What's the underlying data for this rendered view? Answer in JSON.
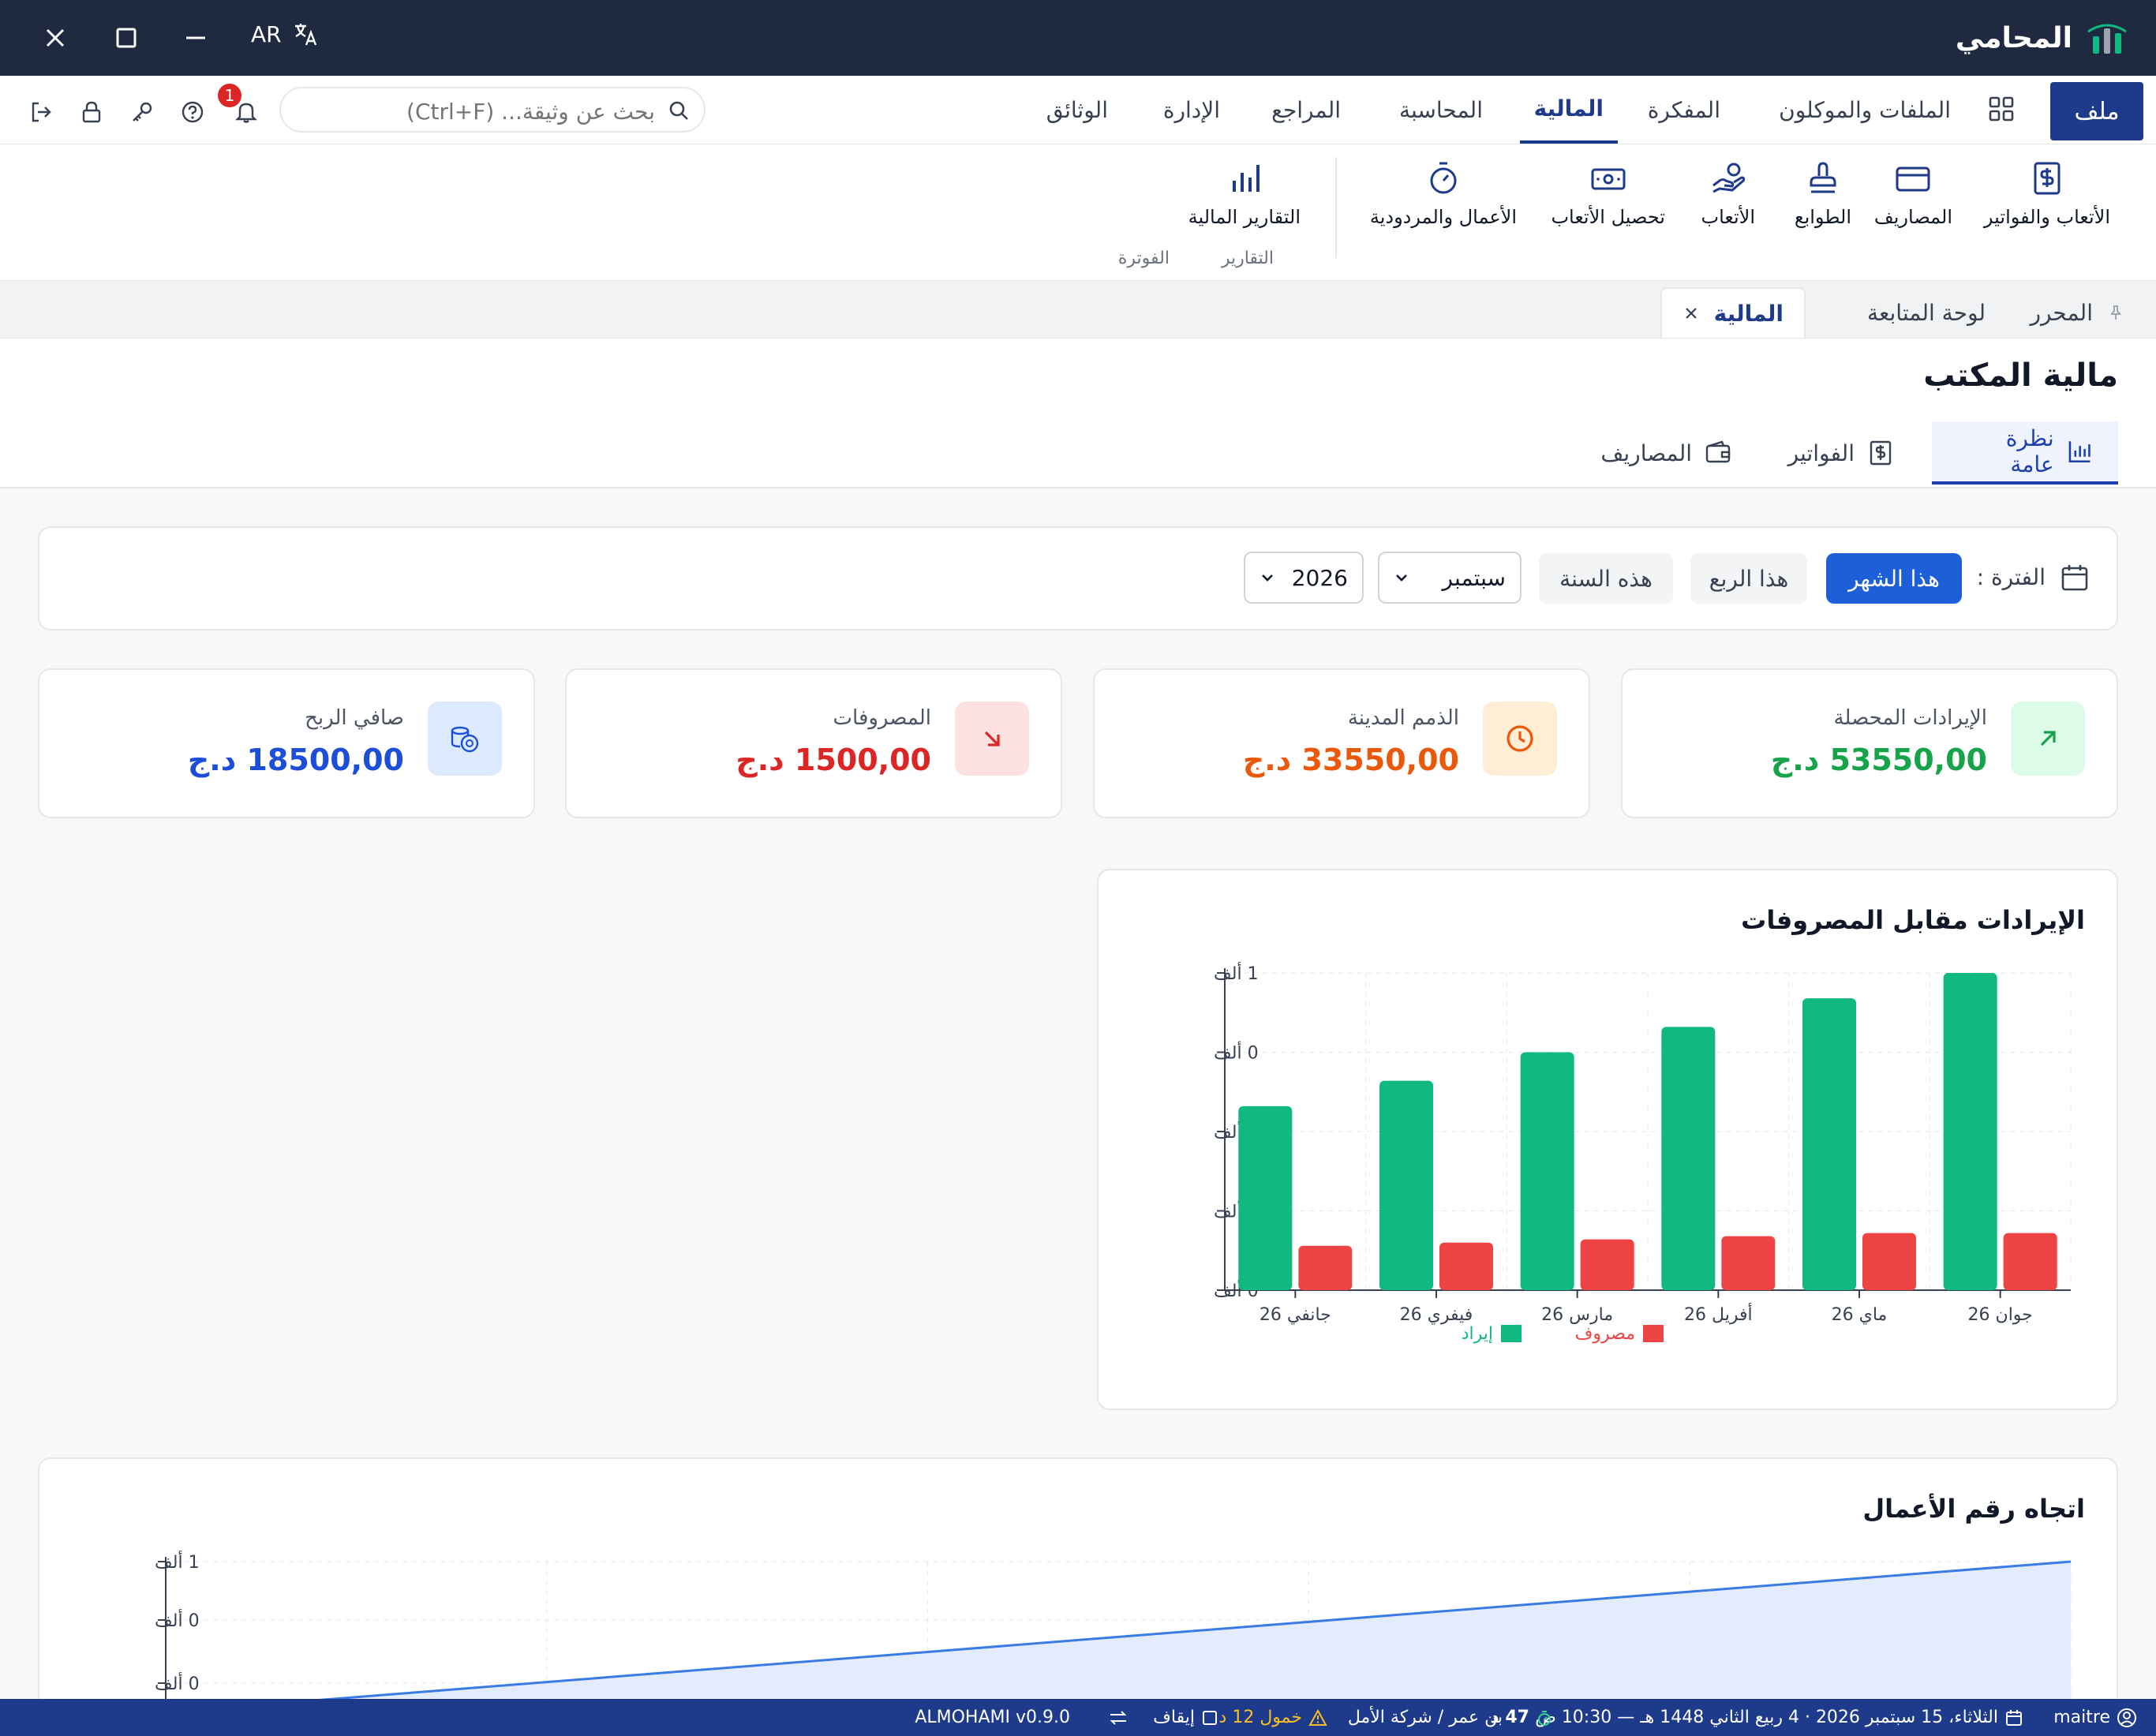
{
  "app": {
    "name": "المحامي",
    "lang": "AR"
  },
  "menu": {
    "file": "ملف",
    "items": [
      "الملفات والموكلون",
      "المفكرة",
      "المالية",
      "المحاسبة",
      "المراجع",
      "الإدارة",
      "الوثائق"
    ],
    "active": "المالية"
  },
  "search": {
    "placeholder": "بحث عن وثيقة... (Ctrl+F)"
  },
  "notifications": {
    "count": "1"
  },
  "ribbon": {
    "billing_group": "الفوترة",
    "reports_group": "التقارير",
    "buttons": [
      {
        "label": "الأتعاب والفواتير",
        "icon": "invoice-dollar-icon"
      },
      {
        "label": "المصاريف",
        "icon": "credit-card-icon"
      },
      {
        "label": "الطوابع",
        "icon": "stamp-icon"
      },
      {
        "label": "الأتعاب",
        "icon": "hand-coins-icon"
      },
      {
        "label": "تحصيل الأتعاب",
        "icon": "banknote-icon"
      },
      {
        "label": "الأعمال والمردودية",
        "icon": "stopwatch-icon"
      },
      {
        "label": "التقارير المالية",
        "icon": "bar-chart-icon"
      }
    ]
  },
  "doc_tabs": {
    "editor": "المحرر",
    "dashboard": "لوحة المتابعة",
    "finance": "المالية"
  },
  "page": {
    "title": "مالية المكتب",
    "tabs": [
      "نظرة عامة",
      "الفواتير",
      "المصاريف"
    ]
  },
  "filter": {
    "label": "الفترة :",
    "this_month": "هذا الشهر",
    "this_quarter": "هذا الربع",
    "this_year": "هذه السنة",
    "month": "سبتمبر",
    "year": "2026"
  },
  "kpis": [
    {
      "label": "الإيرادات المحصلة",
      "value": "53550,00 د.ج",
      "color": "#16a34a",
      "icon": "arrow-up-right-icon"
    },
    {
      "label": "الذمم المدينة",
      "value": "33550,00 د.ج",
      "color": "#ea580c",
      "icon": "clock-icon"
    },
    {
      "label": "المصروفات",
      "value": "1500,00 د.ج",
      "color": "#dc2626",
      "icon": "arrow-down-right-icon"
    },
    {
      "label": "صافي الربح",
      "value": "18500,00 د.ج",
      "color": "#1d4ed8",
      "icon": "coins-icon"
    }
  ],
  "chart_data": [
    {
      "type": "bar",
      "title": "الإيرادات مقابل المصروفات",
      "categories": [
        "جانفي 26",
        "فيفري 26",
        "مارس 26",
        "أفريل 26",
        "ماي 26",
        "جوان 26"
      ],
      "series": [
        {
          "name": "إيراد",
          "color": "#10b981",
          "values": [
            0.58,
            0.66,
            0.75,
            0.83,
            0.92,
            1.0
          ]
        },
        {
          "name": "مصروف",
          "color": "#ef4444",
          "values": [
            0.14,
            0.15,
            0.16,
            0.17,
            0.18,
            0.18
          ]
        }
      ],
      "ytick_labels": [
        "0 ألف",
        "0 ألف",
        "0 ألف",
        "0 ألف",
        "1 ألف"
      ],
      "ylim": [
        0,
        1
      ],
      "grid": true,
      "legend": "bottom"
    },
    {
      "type": "area",
      "title": "اتجاه رقم الأعمال",
      "x": [
        0,
        1,
        2,
        3,
        4,
        5
      ],
      "values": [
        0.4,
        0.52,
        0.64,
        0.76,
        0.88,
        1.0
      ],
      "ytick_labels": [
        "0 ألف",
        "0 ألف",
        "1 ألف"
      ],
      "color": "#3b7be6",
      "grid": true
    }
  ],
  "status": {
    "user": "maitre",
    "date": "الثلاثاء، 15 سبتمبر 2026 · 4 ربيع الثاني 1448 هـ — 10:30 ص",
    "timer": "47 د",
    "client": "بن عمر / شركة الأمل",
    "idle": "خمول 12 د",
    "stop": "إيقاف",
    "version": "ALMOHAMI v0.9.0"
  }
}
